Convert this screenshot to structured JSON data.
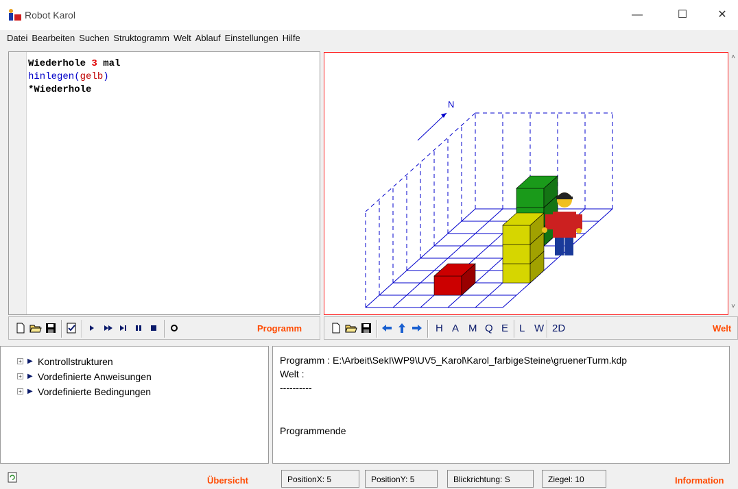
{
  "window": {
    "title": "Robot Karol",
    "controls": {
      "minimize": "—",
      "maximize": "☐",
      "close": "✕"
    }
  },
  "menu": [
    "Datei",
    "Bearbeiten",
    "Suchen",
    "Struktogramm",
    "Welt",
    "Ablauf",
    "Einstellungen",
    "Hilfe"
  ],
  "editor": {
    "line1": {
      "kw": "Wiederhole",
      "num": "3",
      "rest": "mal"
    },
    "line2": {
      "fn": "hinlegen",
      "open": "(",
      "arg": "gelb",
      "close": ")"
    },
    "line3": "*Wiederhole"
  },
  "world": {
    "compass": "N",
    "colors": {
      "grid": "#0000cc",
      "red": "#cc0000",
      "yellow": "#d6d600",
      "green": "#1a9a1a"
    },
    "bricks": [
      {
        "color": "red",
        "x": 2,
        "y": 1,
        "height": 1
      },
      {
        "color": "yellow",
        "x": 4,
        "y": 2,
        "height": 3
      },
      {
        "color": "green",
        "x": 3,
        "y": 5,
        "height": 3
      }
    ]
  },
  "program_toolbar": {
    "label": "Programm",
    "icons": [
      "new-file-icon",
      "open-folder-icon",
      "save-icon",
      "check-icon",
      "run-icon",
      "fast-run-icon",
      "step-icon",
      "pause-icon",
      "stop-icon",
      "record-icon"
    ]
  },
  "world_toolbar": {
    "label": "Welt",
    "icons": [
      "new-file-icon",
      "open-folder-icon",
      "save-icon",
      "turn-left-icon",
      "step-forward-icon",
      "turn-right-icon"
    ],
    "letters": [
      "H",
      "A",
      "M",
      "Q",
      "E",
      "L",
      "W",
      "2D"
    ]
  },
  "overview": {
    "label": "Übersicht",
    "items": [
      "Kontrollstrukturen",
      "Vordefinierte Anweisungen",
      "Vordefinierte Bedingungen"
    ]
  },
  "info": {
    "label": "Information",
    "program": "Programm : E:\\Arbeit\\SekI\\WP9\\UV5_Karol\\Karol_farbigeSteine\\gruenerTurm.kdp",
    "world": "Welt :",
    "separator": "----------",
    "end": "Programmende"
  },
  "status": {
    "position_x": "PositionX: 5",
    "position_y": "PositionY: 5",
    "direction": "Blickrichtung: S",
    "bricks": "Ziegel: 10"
  }
}
